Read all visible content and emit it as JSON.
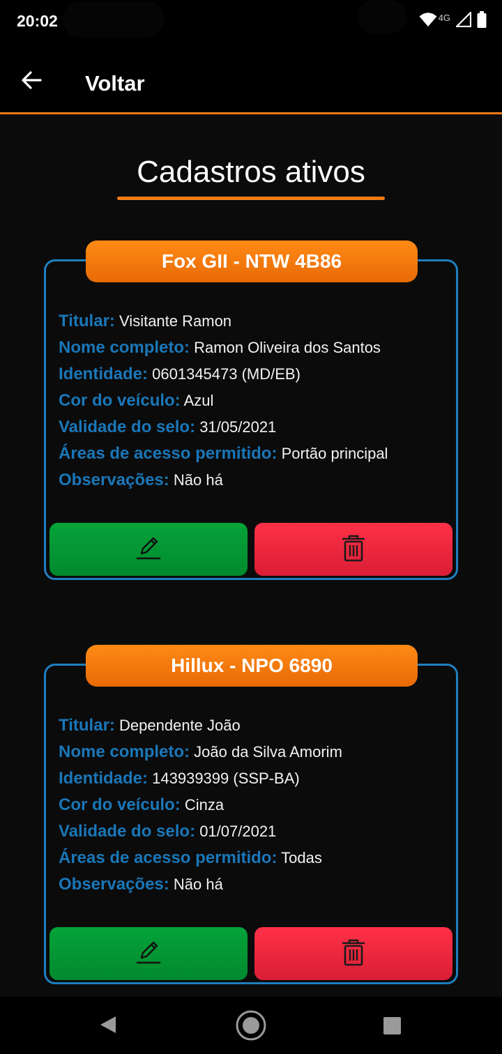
{
  "status_bar": {
    "time": "20:02",
    "network": "4G",
    "icons": [
      "wifi-icon",
      "signal-icon",
      "battery-icon"
    ]
  },
  "app_bar": {
    "back_icon": "arrow-left-icon",
    "title": "Voltar",
    "accent_color": "#f07b14"
  },
  "page": {
    "title": "Cadastros ativos"
  },
  "cards": [
    {
      "header": "Fox GII - NTW 4B86",
      "fields": [
        {
          "label": "Titular:",
          "value": "Visitante Ramon"
        },
        {
          "label": "Nome completo:",
          "value": "Ramon Oliveira dos Santos"
        },
        {
          "label": "Identidade:",
          "value": "0601345473 (MD/EB)"
        },
        {
          "label": "Cor do veículo:",
          "value": "Azul"
        },
        {
          "label": "Validade do selo:",
          "value": "31/05/2021"
        },
        {
          "label": "Áreas de acesso permitido:",
          "value": "Portão principal"
        },
        {
          "label": "Observações:",
          "value": "Não há"
        }
      ],
      "edit_icon": "pencil-icon",
      "delete_icon": "trash-icon"
    },
    {
      "header": "Hillux - NPO 6890",
      "fields": [
        {
          "label": "Titular:",
          "value": "Dependente João"
        },
        {
          "label": "Nome completo:",
          "value": "João da Silva Amorim"
        },
        {
          "label": "Identidade:",
          "value": "143939399 (SSP-BA)"
        },
        {
          "label": "Cor do veículo:",
          "value": "Cinza"
        },
        {
          "label": "Validade do selo:",
          "value": "01/07/2021"
        },
        {
          "label": "Áreas de acesso permitido:",
          "value": "Todas"
        },
        {
          "label": "Observações:",
          "value": "Não há"
        }
      ],
      "edit_icon": "pencil-icon",
      "delete_icon": "trash-icon"
    }
  ],
  "colors": {
    "card_border": "#1f7fc0",
    "label": "#1a77b8",
    "header": "#f07b14",
    "edit_button": "#05a33a",
    "delete_button": "#ff3047"
  },
  "nav_bar": {
    "icons": [
      "nav-back-icon",
      "nav-home-icon",
      "nav-recents-icon"
    ]
  }
}
